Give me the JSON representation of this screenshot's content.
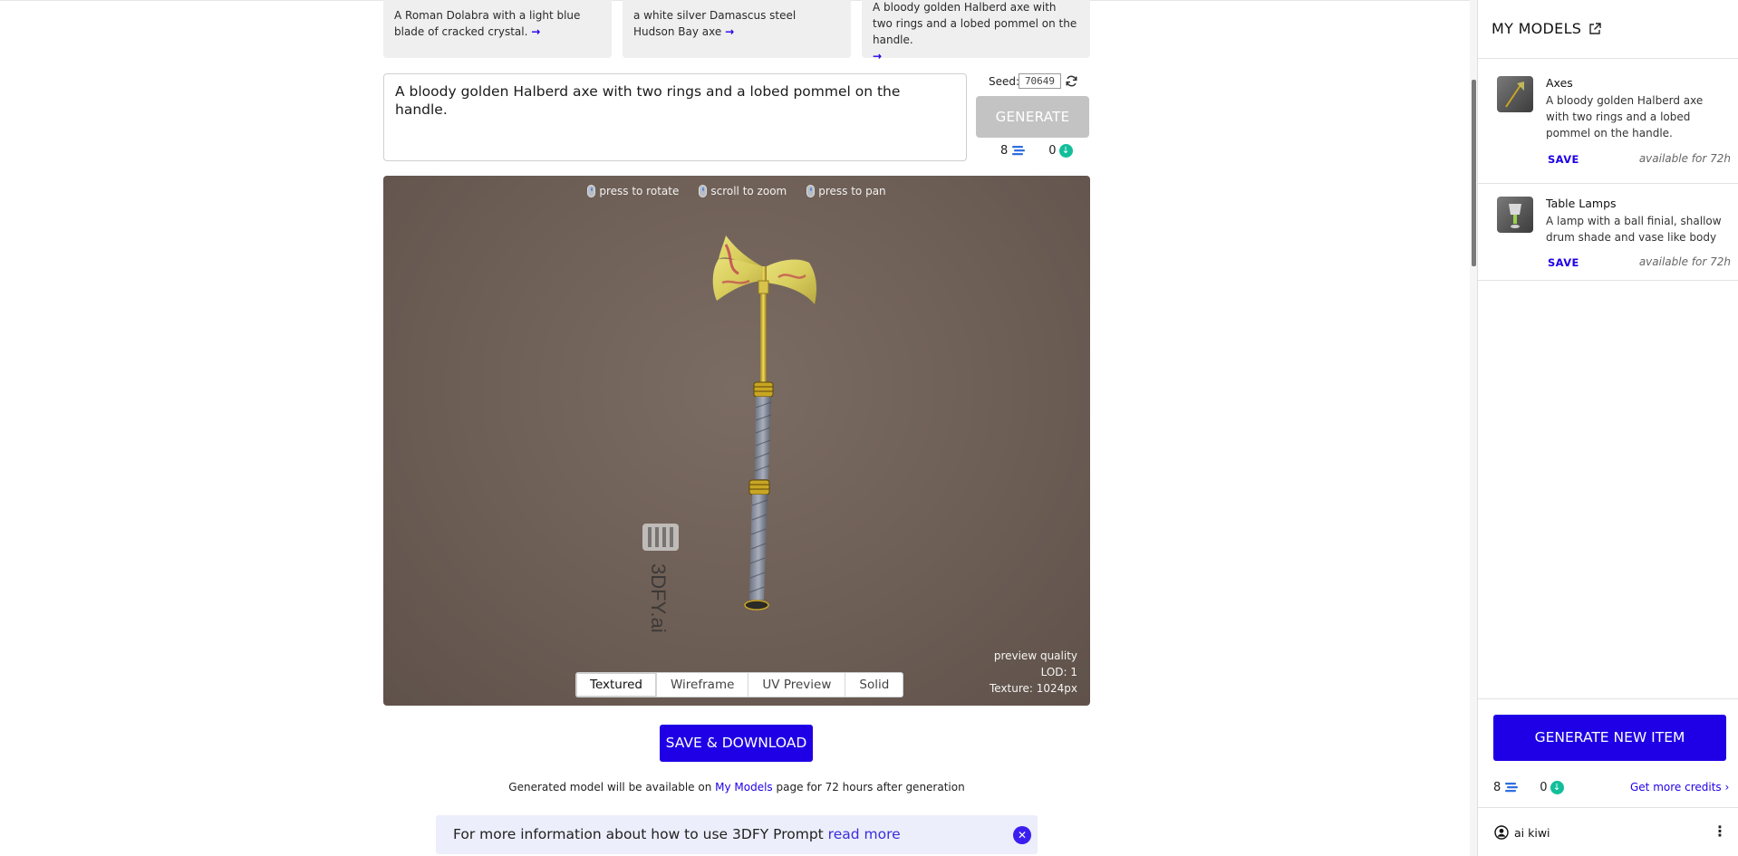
{
  "examples": [
    {
      "text": "A Roman Dolabra with a light blue blade of cracked crystal.",
      "arrow": "→"
    },
    {
      "text": "a white silver Damascus steel Hudson Bay axe",
      "arrow": "→"
    },
    {
      "text": "A bloody golden Halberd axe with two rings and a lobed pommel on the handle.",
      "arrow": "→"
    }
  ],
  "prompt": {
    "value": "A bloody golden Halberd axe with two rings and a lobed pommel on the handle."
  },
  "seed": {
    "label": "Seed:",
    "value": "70649",
    "refresh_icon": "refresh-icon"
  },
  "generate_label": "GENERATE",
  "credits": {
    "prompt_credits": "8",
    "download_credits": "0"
  },
  "viewer": {
    "hints": [
      {
        "label": "press to rotate"
      },
      {
        "label": "scroll to zoom"
      },
      {
        "label": "press to pan"
      }
    ],
    "watermark": "3DFY.ai",
    "quality": {
      "line1": "preview quality",
      "line2": "LOD: 1",
      "line3": "Texture: 1024px"
    },
    "modes": [
      "Textured",
      "Wireframe",
      "UV Preview",
      "Solid"
    ],
    "active_mode": "Textured",
    "background_color": "#706158"
  },
  "save_download_label": "SAVE & DOWNLOAD",
  "availability_note": {
    "before": "Generated model will be available on ",
    "link": "My Models",
    "after": " page for 72 hours after generation"
  },
  "info_banner": {
    "text": "For more information about how to use 3DFY Prompt ",
    "link": "read more"
  },
  "sidebar": {
    "title": "MY MODELS",
    "models": [
      {
        "title": "Axes",
        "description": "A bloody golden Halberd axe with two rings and a lobed pommel on the handle.",
        "save_label": "SAVE",
        "availability": "available for 72h"
      },
      {
        "title": "Table Lamps",
        "description": "A lamp with a ball finial, shallow drum shade and vase like body",
        "save_label": "SAVE",
        "availability": "available for 72h"
      }
    ],
    "generate_new_label": "GENERATE NEW ITEM",
    "prompt_credits": "8",
    "download_credits": "0",
    "get_more_label": "Get more credits ›",
    "user_name": "ai kiwi",
    "menu_icon": "⋮"
  },
  "colors": {
    "accent": "#1f00e6",
    "download_green": "#12bf9a",
    "disabled_button": "#c3c3c3",
    "banner_bg": "#eceefb"
  }
}
